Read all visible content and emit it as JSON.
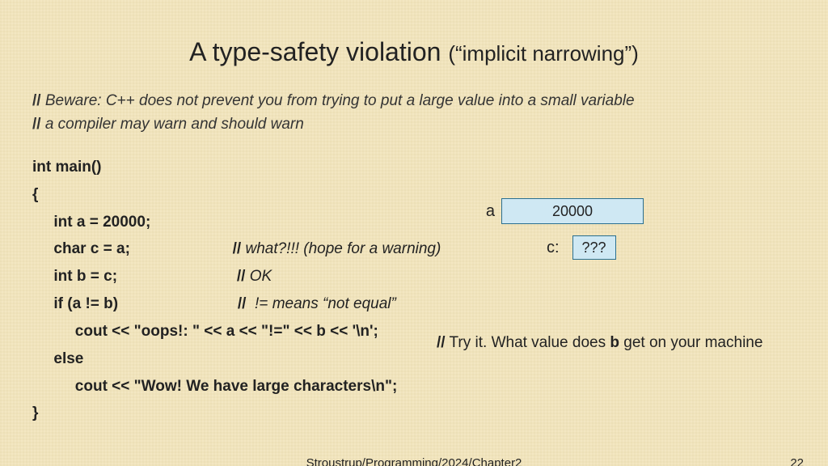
{
  "title_main": "A type-safety violation ",
  "title_sub_open": "(“",
  "title_sub_text": "implicit narrowing",
  "title_sub_close": "”)",
  "comment1": " Beware: C++ does not prevent you from trying to put a large value into a small variable",
  "comment2": " a compiler may warn and should warn",
  "slash": "//",
  "code": {
    "l1": "int main()",
    "l2": "{",
    "l3a": "     int a = 20000;",
    "l4a": "     char c = a;",
    "l4c": " what?!!! (hope for a warning)",
    "l5a": "     int b = c;",
    "l5c": " OK",
    "l6a": "     if (a != b)",
    "l6c": "  != ",
    "l6d": "means “not equal”",
    "l7a": "          cout << \"oops!: \" << a << \"!=\" << b << '\\n';",
    "l8a": "     else",
    "l9a": "          cout << \"Wow! We have large characters\\n\";",
    "l10": "}"
  },
  "note_pre": " Try it. What value does ",
  "note_b": "b",
  "note_post": " get on your machine",
  "diagram": {
    "a_label": "a",
    "a_value": "20000",
    "c_label": "c:",
    "c_value": "???"
  },
  "footer_source": "Stroustrup/Programming/2024/Chapter2",
  "footer_page": "22"
}
